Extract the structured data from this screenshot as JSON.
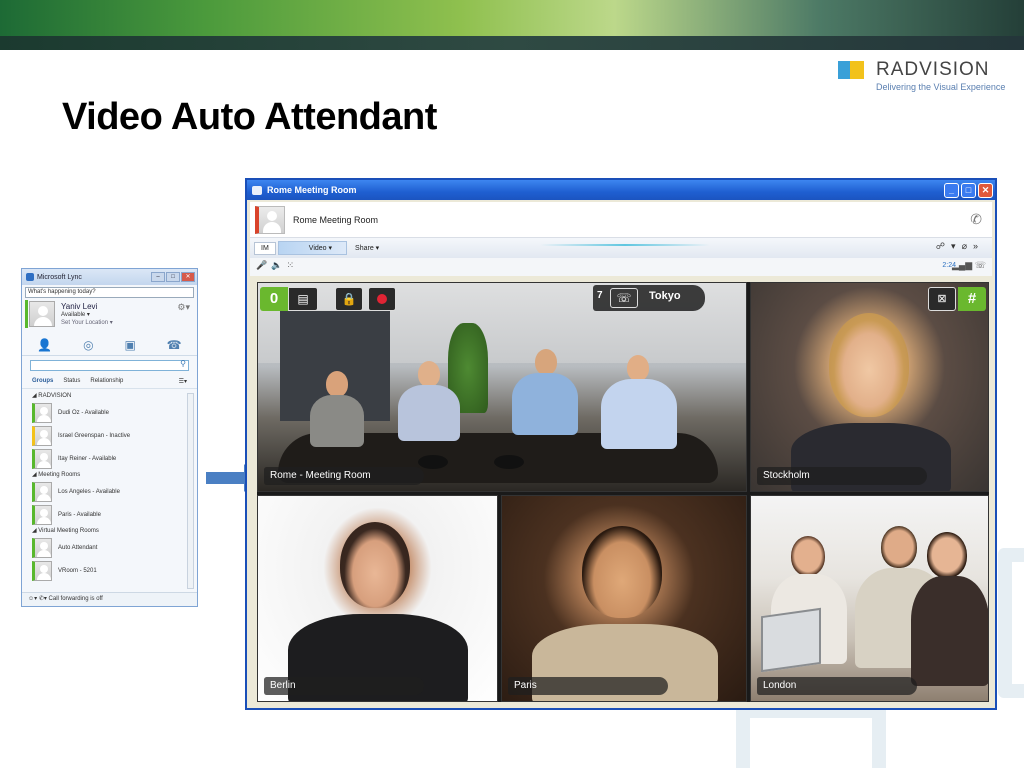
{
  "slide": {
    "title": "Video Auto Attendant",
    "logo_text": "RADVISION",
    "logo_tagline": "Delivering the Visual Experience"
  },
  "colors": {
    "accent_green": "#6ab82e",
    "record_red": "#e02434",
    "window_blue": "#1f5fd1"
  },
  "lync": {
    "window_title": "Microsoft Lync",
    "note_placeholder": "What's happening today?",
    "user_name": "Yaniv Levi",
    "user_status": "Available",
    "user_location": "Set Your Location",
    "tabs": [
      "contacts-icon",
      "activity-icon",
      "conversations-icon",
      "phone-icon"
    ],
    "filter_tabs": [
      "Groups",
      "Status",
      "Relationship"
    ],
    "groups": [
      {
        "name": "RADVISION",
        "contacts": [
          {
            "name": "Dudi Oz - Available",
            "presence": "available"
          },
          {
            "name": "Israel Greenspan - Inactive",
            "presence": "inactive"
          },
          {
            "name": "Itay Reiner - Available",
            "presence": "available"
          }
        ]
      },
      {
        "name": "Meeting Rooms",
        "contacts": [
          {
            "name": "Los Angeles - Available",
            "presence": "available"
          },
          {
            "name": "Paris - Available",
            "presence": "available"
          }
        ]
      },
      {
        "name": "Virtual Meeting Rooms",
        "contacts": [
          {
            "name": "Auto Attendant",
            "presence": "available"
          },
          {
            "name": "VRoom - 5201",
            "presence": "available"
          }
        ]
      }
    ],
    "footer_text": "Call forwarding is off"
  },
  "conference": {
    "window_title": "Rome Meeting Room",
    "contact_name": "Rome Meeting Room",
    "toolbar": {
      "im_label": "IM",
      "video_label": "Video",
      "share_label": "Share"
    },
    "duration": "2:24",
    "overlay": {
      "left_digit": "0",
      "right_symbol": "#",
      "tokyo_number": "7",
      "tokyo_city": "Tokyo"
    },
    "tiles": [
      {
        "id": "rome",
        "label": "Rome - Meeting Room"
      },
      {
        "id": "stockholm",
        "label": "Stockholm"
      },
      {
        "id": "berlin",
        "label": "Berlin"
      },
      {
        "id": "paris",
        "label": "Paris"
      },
      {
        "id": "london",
        "label": "London"
      }
    ]
  }
}
